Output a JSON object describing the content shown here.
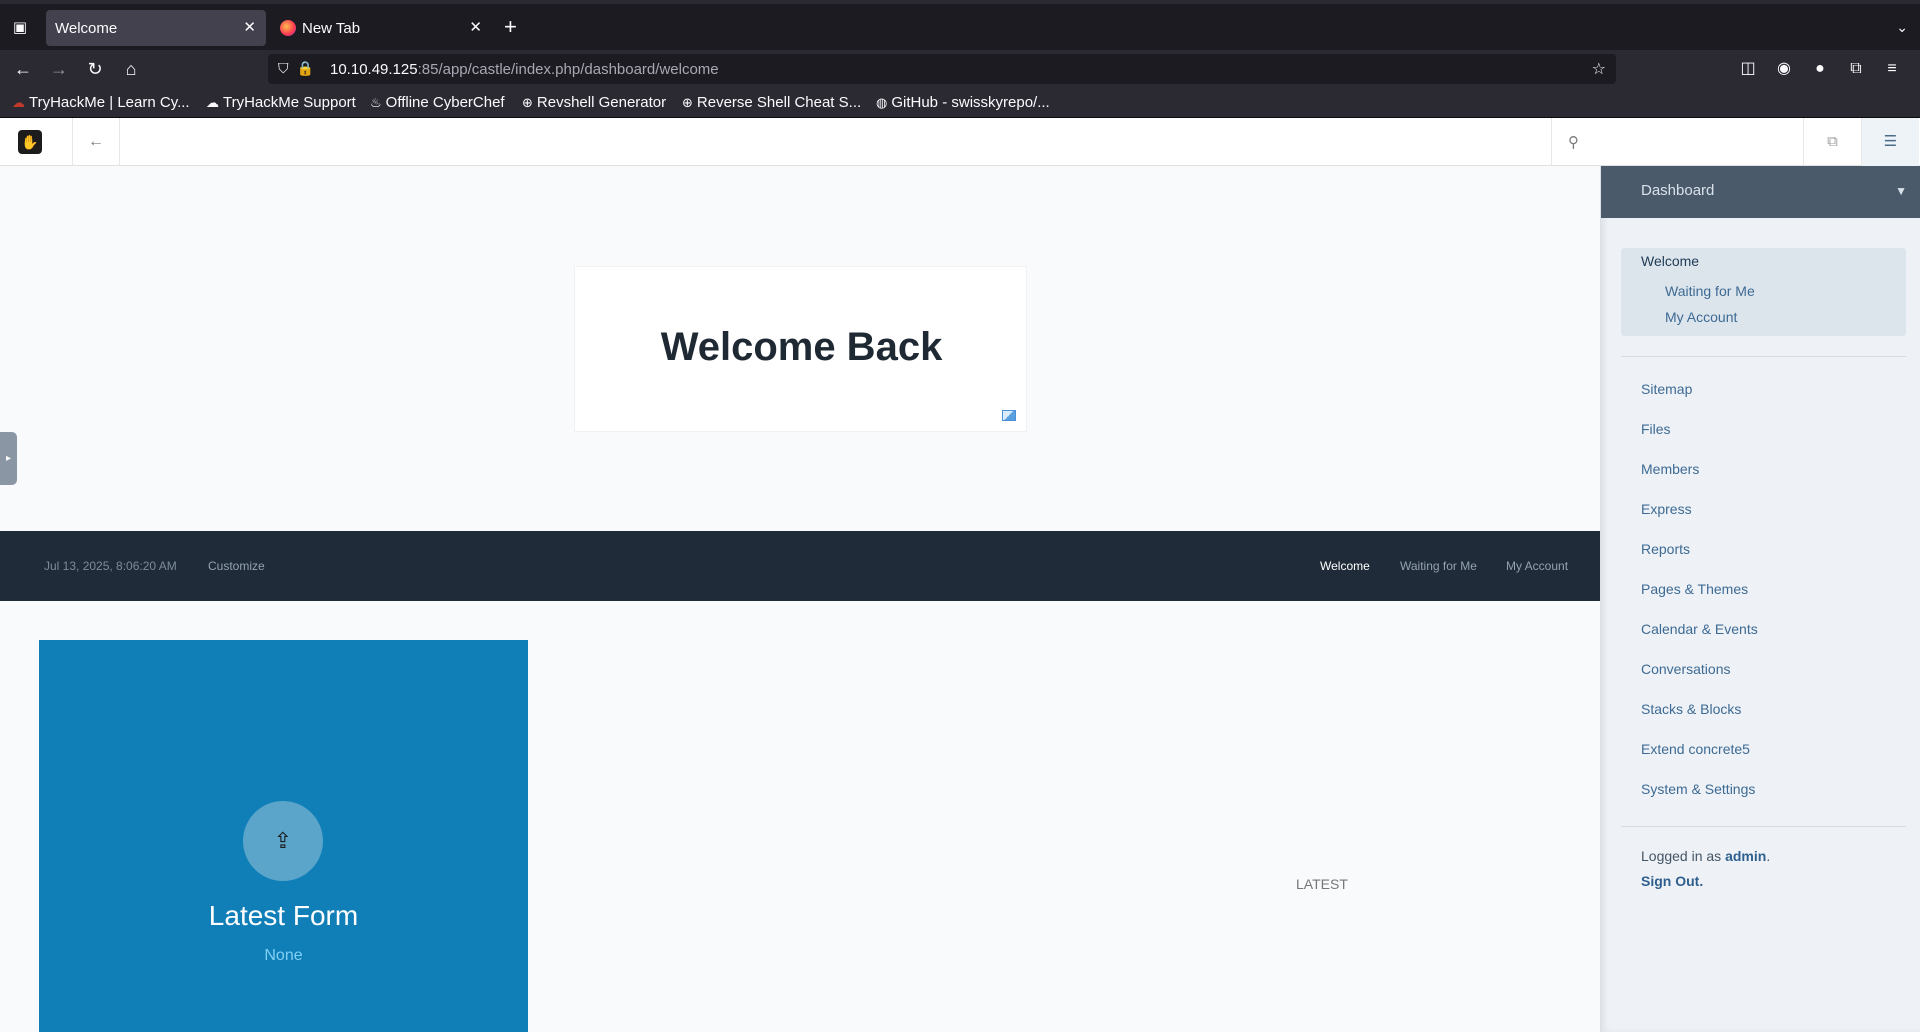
{
  "browser": {
    "tabs": [
      {
        "label": "Welcome",
        "active": true
      },
      {
        "label": "New Tab",
        "active": false
      }
    ],
    "url": {
      "host": "10.10.49.125",
      "rest": ":85/app/castle/index.php/dashboard/welcome"
    },
    "bookmarks": [
      "TryHackMe | Learn Cy...",
      "TryHackMe Support",
      "Offline CyberChef",
      "Revshell Generator",
      "Reverse Shell Cheat S...",
      "GitHub - swisskyrepo/..."
    ]
  },
  "hero": {
    "title": "Welcome Back"
  },
  "dash_bar": {
    "date": "Jul 13, 2025, 8:06:20 AM",
    "customize": "Customize",
    "nav": [
      "Welcome",
      "Waiting for Me",
      "My Account"
    ]
  },
  "tile": {
    "title": "Latest Form",
    "value": "None"
  },
  "latest": {
    "label": "LATEST"
  },
  "panel": {
    "header": "Dashboard",
    "welcome_group": [
      "Welcome",
      "Waiting for Me",
      "My Account"
    ],
    "items": [
      "Sitemap",
      "Files",
      "Members",
      "Express",
      "Reports",
      "Pages & Themes",
      "Calendar & Events",
      "Conversations",
      "Stacks & Blocks",
      "Extend concrete5",
      "System & Settings"
    ],
    "logged_prefix": "Logged in as",
    "user": "admin",
    "logged_suffix": ".",
    "sign_out": "Sign Out."
  },
  "colors": {
    "tile": "#117fb7",
    "dash_bar": "#1f2b38",
    "panel_head": "#4a5a6a",
    "link": "#3d6a94"
  }
}
